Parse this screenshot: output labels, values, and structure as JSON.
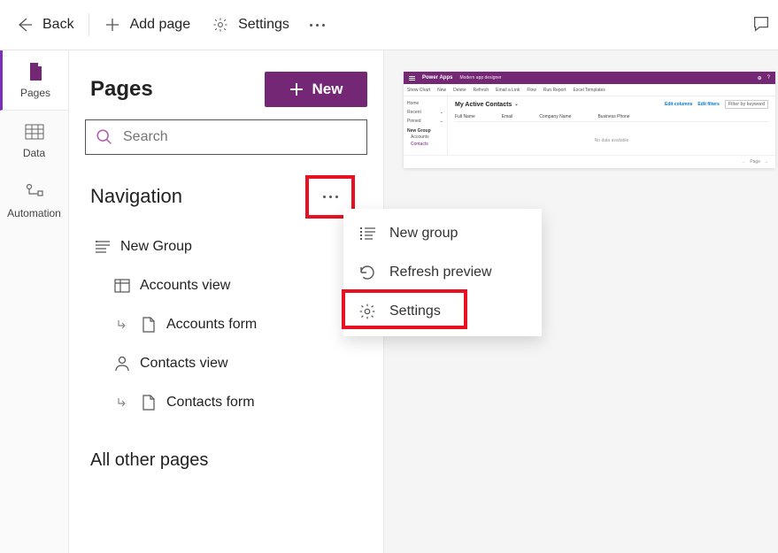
{
  "toolbar": {
    "back_label": "Back",
    "add_page_label": "Add page",
    "settings_label": "Settings"
  },
  "left_rail": {
    "items": [
      {
        "label": "Pages"
      },
      {
        "label": "Data"
      },
      {
        "label": "Automation"
      }
    ]
  },
  "pages_panel": {
    "title": "Pages",
    "new_button": "New",
    "search_placeholder": "Search",
    "navigation_title": "Navigation",
    "all_other_title": "All other pages",
    "tree": {
      "group_label": "New Group",
      "items": [
        {
          "label": "Accounts view"
        },
        {
          "label": "Accounts form"
        },
        {
          "label": "Contacts view"
        },
        {
          "label": "Contacts form"
        }
      ]
    }
  },
  "context_menu": {
    "items": [
      {
        "label": "New group"
      },
      {
        "label": "Refresh preview"
      },
      {
        "label": "Settings"
      }
    ]
  },
  "preview": {
    "app_title": "Power Apps",
    "app_subtitle": "Modern app designer",
    "cmd": {
      "show_chart": "Show Chart",
      "new": "New",
      "delete": "Delete",
      "refresh": "Refresh",
      "email_link": "Email a Link",
      "flow": "Flow",
      "run_report": "Run Report",
      "excel": "Excel Templates"
    },
    "sidebar": {
      "home": "Home",
      "recent": "Recent",
      "pinned": "Pinned",
      "group": "New Group",
      "accounts": "Accounts",
      "contacts": "Contacts"
    },
    "view": {
      "title": "My Active Contacts",
      "edit_columns": "Edit columns",
      "edit_filters": "Edit filters",
      "filter_placeholder": "Filter by keyword",
      "col_fullname": "Full Name",
      "col_email": "Email",
      "col_company": "Company Name",
      "col_phone": "Business Phone",
      "no_data": "No data available",
      "page": "Page"
    }
  }
}
